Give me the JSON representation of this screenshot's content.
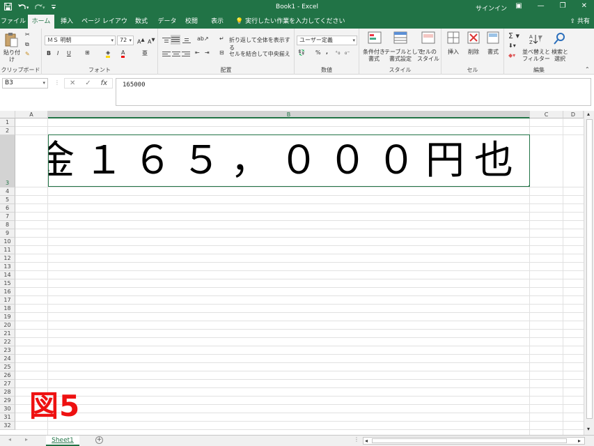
{
  "titlebar": {
    "title": "Book1 - Excel",
    "signin": "サインイン",
    "save_icon": "save-icon",
    "undo_icon": "undo-icon",
    "redo_icon": "redo-icon",
    "customize_icon": "customize-icon"
  },
  "tabs": [
    {
      "label": "ファイル"
    },
    {
      "label": "ホーム"
    },
    {
      "label": "挿入"
    },
    {
      "label": "ページ レイアウト"
    },
    {
      "label": "数式"
    },
    {
      "label": "データ"
    },
    {
      "label": "校閲"
    },
    {
      "label": "表示"
    }
  ],
  "tellme": "実行したい作業を入力してください",
  "share": "共有",
  "ribbon": {
    "clipboard": {
      "paste": "貼り付け",
      "name": "クリップボード"
    },
    "font": {
      "name_value": "ＭＳ 明朝",
      "size_value": "72",
      "bold": "B",
      "italic": "I",
      "underline": "U",
      "group": "フォント"
    },
    "align": {
      "wrap": "折り返して全体を表示する",
      "merge": "セルを結合して中央揃え",
      "group": "配置"
    },
    "number": {
      "format": "ユーザー定義",
      "percent": "%",
      "comma": ",",
      "group": "数値"
    },
    "styles": {
      "cond": "条件付き\n書式",
      "table": "テーブルとして\n書式設定",
      "cell": "セルの\nスタイル",
      "group": "スタイル"
    },
    "cells": {
      "insert": "挿入",
      "delete": "削除",
      "format": "書式",
      "group": "セル"
    },
    "edit": {
      "sort": "並べ替えと\nフィルター",
      "find": "検索と\n選択",
      "group": "編集"
    }
  },
  "formula_bar": {
    "name_box": "B3",
    "cancel": "✕",
    "enter": "✓",
    "fx": "fx",
    "content": "165000"
  },
  "sheet": {
    "columns": [
      "A",
      "B",
      "C",
      "D"
    ],
    "rows": [
      "1",
      "2",
      "3",
      "4",
      "5",
      "6",
      "7",
      "8",
      "9",
      "10",
      "11",
      "12",
      "13",
      "14",
      "15",
      "16",
      "17",
      "18",
      "19",
      "20",
      "21",
      "22",
      "23",
      "24",
      "25",
      "26",
      "27",
      "28",
      "29",
      "30",
      "31",
      "32"
    ],
    "cell_b3": "金１６５，０００円也"
  },
  "figure_label": "図5",
  "sheet_tab": "Sheet1",
  "colors": {
    "excel_green": "#217346",
    "figure_red": "#ee1111"
  }
}
